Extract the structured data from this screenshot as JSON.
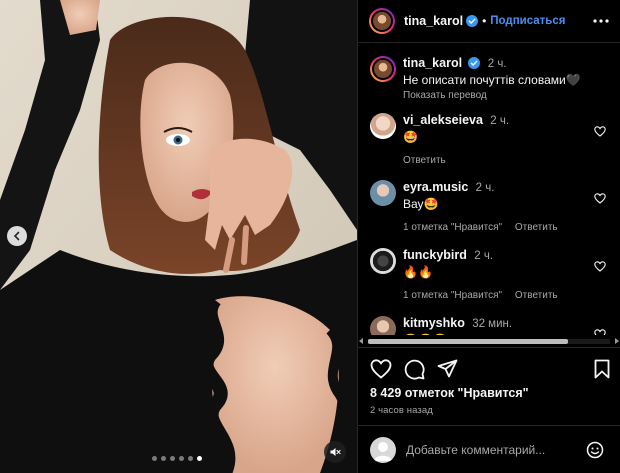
{
  "post": {
    "author": "tina_karol",
    "follow_label": "Подписаться",
    "separator": "•",
    "caption": {
      "username": "tina_karol",
      "time": "2 ч.",
      "text": "Не описати почуттів словами🖤",
      "translate_label": "Показать перевод"
    },
    "comments": [
      {
        "username": "vi_alekseieva",
        "time": "2 ч.",
        "text": "🤩",
        "likes_label": "",
        "reply_label": "Ответить"
      },
      {
        "username": "eyra.music",
        "time": "2 ч.",
        "text": "Вау🤩",
        "likes_label": "1 отметка \"Нравится\"",
        "reply_label": "Ответить"
      },
      {
        "username": "funckybird",
        "time": "2 ч.",
        "text": "🔥🔥",
        "likes_label": "1 отметка \"Нравится\"",
        "reply_label": "Ответить"
      },
      {
        "username": "kitmyshko",
        "time": "32 мин.",
        "text": "😍😍😍",
        "likes_label": "",
        "reply_label": ""
      }
    ],
    "likes": "8 429 отметок \"Нравится\"",
    "posted_ago": "2 часов назад",
    "add_comment_placeholder": "Добавьте комментарий...",
    "carousel": {
      "count": 6,
      "active_index": 5
    }
  },
  "icons": {
    "verified": "verified-badge-icon",
    "more": "more-horizontal-icon",
    "like": "heart-icon",
    "comment": "comment-bubble-icon",
    "share": "paper-plane-icon",
    "save": "bookmark-icon",
    "emoji": "smiley-icon",
    "carousel_prev": "chevron-left-icon",
    "mute": "speaker-muted-icon"
  },
  "colors": {
    "background": "#000000",
    "link_blue": "#4a8ff2",
    "secondary_text": "#a8a8a8",
    "photo_backdrop": "#d8cfc0"
  }
}
